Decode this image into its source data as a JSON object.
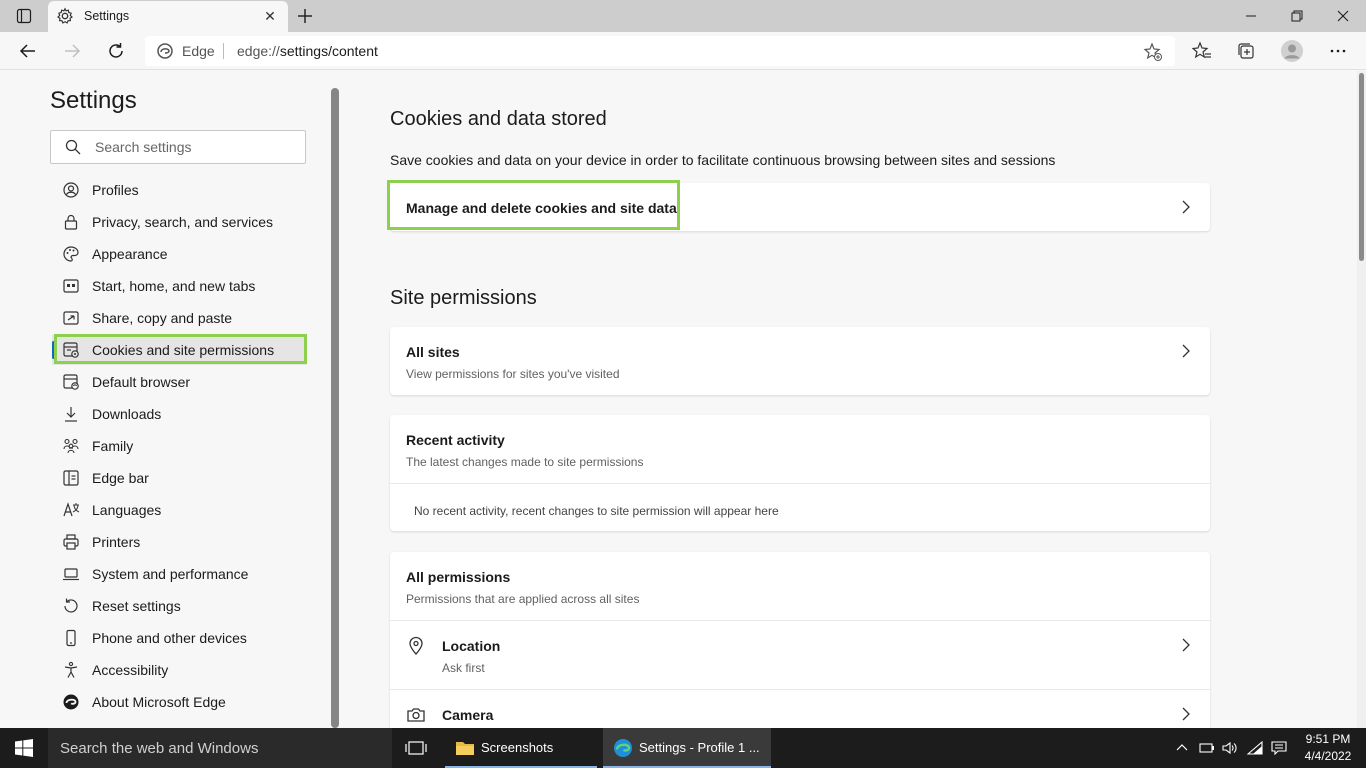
{
  "browser": {
    "tab_title": "Settings",
    "site_name": "Edge",
    "url_scheme": "edge://",
    "url_path": "settings/content"
  },
  "sidebar": {
    "title": "Settings",
    "search_placeholder": "Search settings",
    "items": [
      {
        "label": "Profiles",
        "icon": "profile-icon"
      },
      {
        "label": "Privacy, search, and services",
        "icon": "lock-icon"
      },
      {
        "label": "Appearance",
        "icon": "palette-icon"
      },
      {
        "label": "Start, home, and new tabs",
        "icon": "home-tabs-icon"
      },
      {
        "label": "Share, copy and paste",
        "icon": "share-icon"
      },
      {
        "label": "Cookies and site permissions",
        "icon": "cookies-icon",
        "active": true
      },
      {
        "label": "Default browser",
        "icon": "browser-icon"
      },
      {
        "label": "Downloads",
        "icon": "download-icon"
      },
      {
        "label": "Family",
        "icon": "family-icon"
      },
      {
        "label": "Edge bar",
        "icon": "edge-bar-icon"
      },
      {
        "label": "Languages",
        "icon": "languages-icon"
      },
      {
        "label": "Printers",
        "icon": "printer-icon"
      },
      {
        "label": "System and performance",
        "icon": "laptop-icon"
      },
      {
        "label": "Reset settings",
        "icon": "reset-icon"
      },
      {
        "label": "Phone and other devices",
        "icon": "phone-icon"
      },
      {
        "label": "Accessibility",
        "icon": "accessibility-icon"
      },
      {
        "label": "About Microsoft Edge",
        "icon": "edge-icon"
      }
    ]
  },
  "main": {
    "cookies_heading": "Cookies and data stored",
    "cookies_desc": "Save cookies and data on your device in order to facilitate continuous browsing between sites and sessions",
    "manage_cookies_label": "Manage and delete cookies and site data",
    "site_permissions_heading": "Site permissions",
    "all_sites": {
      "title": "All sites",
      "subtitle": "View permissions for sites you've visited"
    },
    "recent_activity": {
      "title": "Recent activity",
      "subtitle": "The latest changes made to site permissions",
      "empty_note": "No recent activity, recent changes to site permission will appear here"
    },
    "all_permissions": {
      "title": "All permissions",
      "subtitle": "Permissions that are applied across all sites",
      "rows": [
        {
          "title": "Location",
          "subtitle": "Ask first",
          "icon": "location-icon"
        },
        {
          "title": "Camera",
          "subtitle": "",
          "icon": "camera-icon"
        }
      ]
    }
  },
  "taskbar": {
    "search_placeholder": "Search the web and Windows",
    "apps": [
      {
        "label": "Screenshots",
        "icon": "folder-icon"
      },
      {
        "label": "Settings - Profile 1 ...",
        "icon": "edge-icon",
        "active": true
      }
    ],
    "time": "9:51 PM",
    "date": "4/4/2022"
  },
  "colors": {
    "highlight": "#8cd04e",
    "accent": "#0f6cbd"
  }
}
